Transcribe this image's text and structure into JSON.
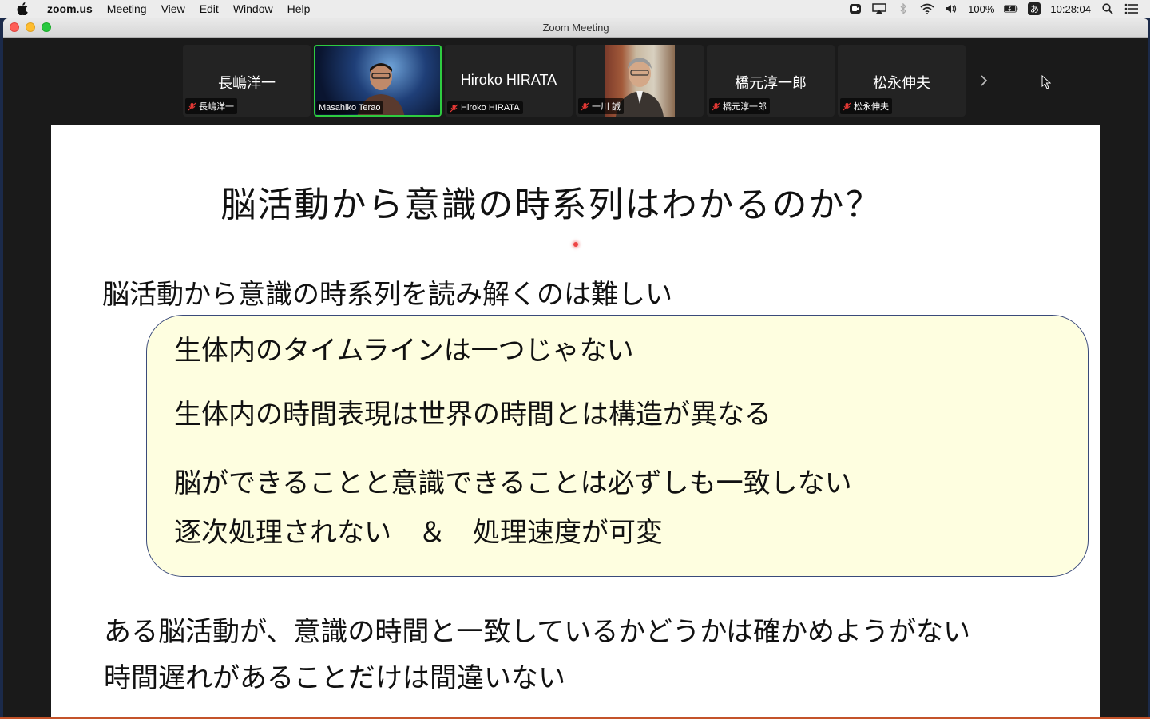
{
  "menubar": {
    "app_name": "zoom.us",
    "menus": [
      "Meeting",
      "View",
      "Edit",
      "Window",
      "Help"
    ],
    "battery": "100%",
    "input_method": "あ",
    "clock": "10:28:04"
  },
  "window": {
    "title": "Zoom Meeting"
  },
  "participants": [
    {
      "center_name": "長嶋洋一",
      "tag": "長嶋洋一",
      "muted": true,
      "video": false
    },
    {
      "center_name": "",
      "tag": "Masahiko Terao",
      "muted": false,
      "video": true,
      "active_speaker": true
    },
    {
      "center_name": "Hiroko HIRATA",
      "tag": "Hiroko HIRATA",
      "muted": true,
      "video": false
    },
    {
      "center_name": "",
      "tag": "一川 誠",
      "muted": true,
      "video": true
    },
    {
      "center_name": "橋元淳一郎",
      "tag": "橋元淳一郎",
      "muted": true,
      "video": false
    },
    {
      "center_name": "松永伸夫",
      "tag": "松永伸夫",
      "muted": true,
      "video": false
    }
  ],
  "slide": {
    "title": "脳活動から意識の時系列はわかるのか？",
    "subtitle": "脳活動から意識の時系列を読み解くのは難しい",
    "box_lines": [
      "生体内のタイムラインは一つじゃない",
      "生体内の時間表現は世界の時間とは構造が異なる",
      "脳ができることと意識できることは必ずしも一致しない",
      "逐次処理されない　＆　処理速度が可変"
    ],
    "bottom_lines": [
      "ある脳活動が、意識の時間と一致しているかどうかは確かめようがない",
      "時間遅れがあることだけは間違いない"
    ]
  },
  "colors": {
    "active_speaker_border": "#2ecc40",
    "box_fill": "#fefee0",
    "box_border": "#3a4a7a",
    "mute_icon": "#e53935"
  }
}
